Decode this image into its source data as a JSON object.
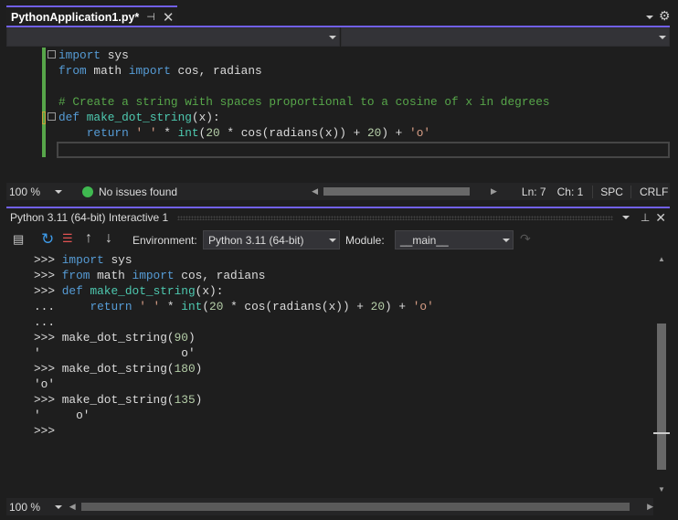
{
  "tab": {
    "title": "PythonApplication1.py*",
    "pin_icon": "pin-icon",
    "close_icon": "close-icon"
  },
  "window_controls": {
    "dropdown_icon": "chevron-down-icon",
    "settings_icon": "gear-icon"
  },
  "editor": {
    "lines": [
      [
        [
          "k",
          "import"
        ],
        [
          "p",
          " sys"
        ]
      ],
      [
        [
          "k",
          "from"
        ],
        [
          "p",
          " math "
        ],
        [
          "k",
          "import"
        ],
        [
          "p",
          " cos, radians"
        ]
      ],
      [],
      [
        [
          "c",
          "# Create a string with spaces proportional to a cosine of x in degrees"
        ]
      ],
      [
        [
          "k",
          "def"
        ],
        [
          "p",
          " "
        ],
        [
          "f",
          "make_dot_string"
        ],
        [
          "p",
          "(x):"
        ]
      ],
      [
        [
          "p",
          "    "
        ],
        [
          "k",
          "return"
        ],
        [
          "p",
          " "
        ],
        [
          "s",
          "' '"
        ],
        [
          "p",
          " * "
        ],
        [
          "f",
          "int"
        ],
        [
          "p",
          "("
        ],
        [
          "n",
          "20"
        ],
        [
          "p",
          " * cos(radians(x)) + "
        ],
        [
          "n",
          "20"
        ],
        [
          "p",
          ") + "
        ],
        [
          "s",
          "'o'"
        ]
      ],
      []
    ]
  },
  "editor_status": {
    "zoom": "100 %",
    "issues": "No issues found",
    "line": "Ln: 7",
    "char": "Ch: 1",
    "indent": "SPC",
    "eol": "CRLF"
  },
  "interactive": {
    "title": "Python 3.11 (64-bit) Interactive 1",
    "environment_label": "Environment:",
    "environment_value": "Python 3.11 (64-bit)",
    "module_label": "Module:",
    "module_value": "__main__",
    "lines": [
      [
        [
          "p",
          ">>> "
        ],
        [
          "k",
          "import"
        ],
        [
          "p",
          " sys"
        ]
      ],
      [
        [
          "p",
          ">>> "
        ],
        [
          "k",
          "from"
        ],
        [
          "p",
          " math "
        ],
        [
          "k",
          "import"
        ],
        [
          "p",
          " cos, radians"
        ]
      ],
      [
        [
          "p",
          ">>> "
        ],
        [
          "k",
          "def"
        ],
        [
          "p",
          " "
        ],
        [
          "f",
          "make_dot_string"
        ],
        [
          "p",
          "(x):"
        ]
      ],
      [
        [
          "p",
          "...     "
        ],
        [
          "k",
          "return"
        ],
        [
          "p",
          " "
        ],
        [
          "s",
          "' '"
        ],
        [
          "p",
          " * "
        ],
        [
          "f",
          "int"
        ],
        [
          "p",
          "("
        ],
        [
          "n",
          "20"
        ],
        [
          "p",
          " * cos(radians(x)) + "
        ],
        [
          "n",
          "20"
        ],
        [
          "p",
          ") + "
        ],
        [
          "s",
          "'o'"
        ]
      ],
      [
        [
          "p",
          "..."
        ]
      ],
      [
        [
          "p",
          ">>> make_dot_string("
        ],
        [
          "n",
          "90"
        ],
        [
          "p",
          ")"
        ]
      ],
      [
        [
          "p",
          "'                    o'"
        ]
      ],
      [
        [
          "p",
          ">>> make_dot_string("
        ],
        [
          "n",
          "180"
        ],
        [
          "p",
          ")"
        ]
      ],
      [
        [
          "p",
          "'o'"
        ]
      ],
      [
        [
          "p",
          ">>> make_dot_string("
        ],
        [
          "n",
          "135"
        ],
        [
          "p",
          ")"
        ]
      ],
      [
        [
          "p",
          "'     o'"
        ]
      ],
      [
        [
          "p",
          ">>>"
        ]
      ]
    ],
    "zoom": "100 %"
  },
  "colors": {
    "accent": "#7160e8",
    "keyword": "#569cd6",
    "function": "#4ec9b0",
    "comment": "#57a64a",
    "string": "#d69d85",
    "number": "#b5cea8",
    "change_bar": "#57a64a"
  }
}
